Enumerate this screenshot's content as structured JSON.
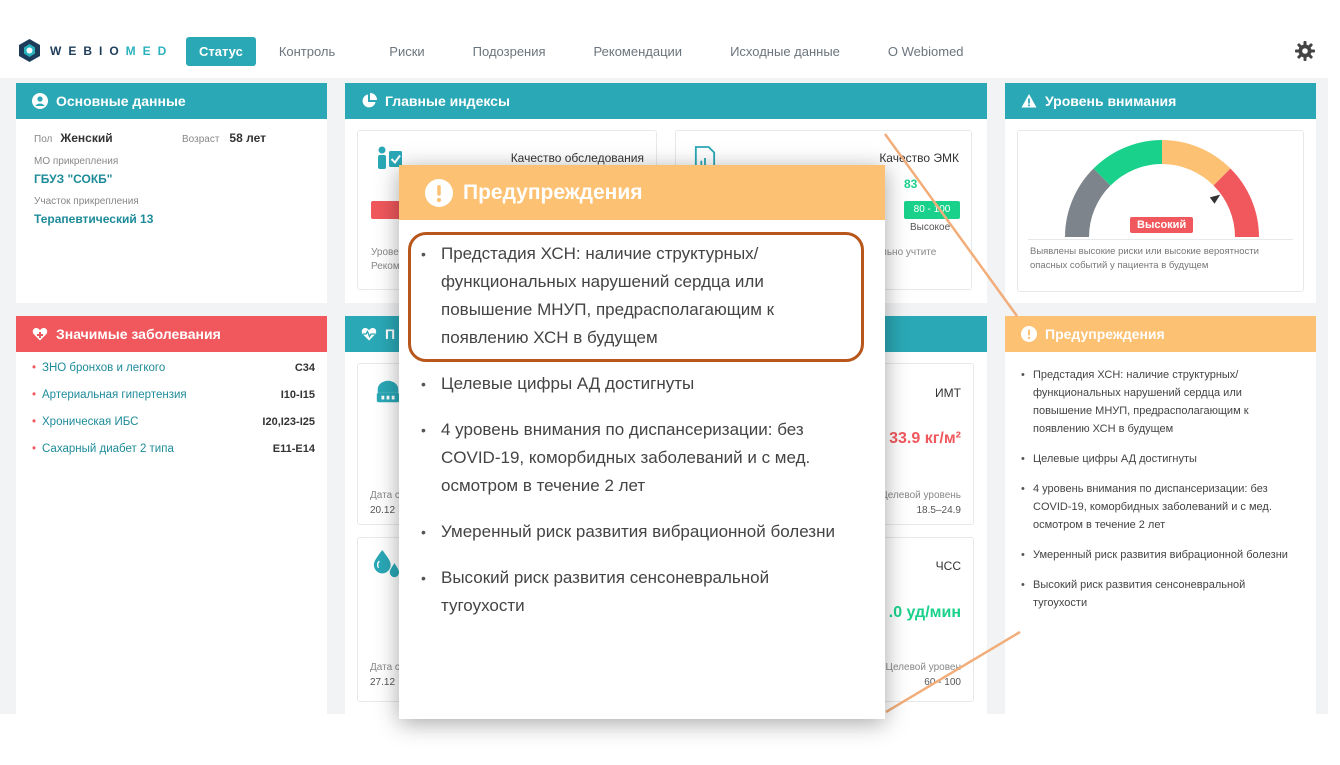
{
  "brand": {
    "name_part1": "WEBIO",
    "name_part2": "MED"
  },
  "nav": {
    "items": [
      {
        "label": "Статус",
        "active": true
      },
      {
        "label": "Контроль",
        "active": false
      },
      {
        "label": "Риски",
        "active": false
      },
      {
        "label": "Подозрения",
        "active": false
      },
      {
        "label": "Рекомендации",
        "active": false
      },
      {
        "label": "Исходные данные",
        "active": false
      },
      {
        "label": "О Webiomed",
        "active": false
      }
    ]
  },
  "basic": {
    "title": "Основные данные",
    "sex_label": "Пол",
    "sex_value": "Женский",
    "age_label": "Возраст",
    "age_value": "58 лет",
    "mo_label": "МО прикрепления",
    "mo_value": "ГБУЗ \"СОКБ\"",
    "district_label": "Участок прикрепления",
    "district_value": "Терапевтический 13"
  },
  "diseases": {
    "title": "Значимые заболевания",
    "items": [
      {
        "name": "ЗНО бронхов и легкого",
        "code": "C34"
      },
      {
        "name": "Артериальная гипертензия",
        "code": "I10-I15"
      },
      {
        "name": "Хроническая ИБС",
        "code": "I20,I23-I25"
      },
      {
        "name": "Сахарный диабет 2 типа",
        "code": "E11-E14"
      }
    ]
  },
  "indices": {
    "title": "Главные индексы",
    "card1_title": "Качество обследования",
    "card1_note": "Урове",
    "card1_note2": "Реком",
    "card2_title": "Качество ЭМК",
    "card2_value": "83",
    "card2_range": "80 - 100",
    "card2_level": "Высокое",
    "card2_note": "льно учтите"
  },
  "params": {
    "title_visible": "П",
    "imt_label": "ИМТ",
    "imt_value": "33.9 кг/м²",
    "imt_date_label": "Дата с",
    "imt_date": "20.12",
    "imt_target_label": "Целевой уровень",
    "imt_target": "18.5–24.9",
    "hr_label": "ЧСС",
    "hr_value": ".0 уд/мин",
    "hr_date_label": "Дата с",
    "hr_date": "27.12",
    "hr_target_label": "Целевой уровен",
    "hr_target": "60 - 100"
  },
  "attention": {
    "title": "Уровень внимания",
    "gauge_label": "Высокий",
    "gauge_level": 0.8,
    "description": "Выявлены высокие риски или высокие вероятности опасных событий у пациента в будущем"
  },
  "warnings": {
    "title": "Предупреждения",
    "items": [
      "Предстадия ХСН: наличие структурных/функциональных нарушений сердца или повышение МНУП, предрасполагающим к появлению ХСН в будущем",
      "Целевые цифры АД достигнуты",
      "4 уровень внимания по диспансеризации: без COVID-19, коморбидных заболеваний и с мед. осмотром в течение 2 лет",
      "Умеренный риск развития вибрационной болезни",
      "Высокий риск развития сенсоневральной тугоухости"
    ]
  },
  "modal": {
    "title": "Предупреждения",
    "items": [
      "Предстадия ХСН: наличие структурных/ функциональных нарушений сердца или повышение МНУП, предрасполагающим к появлению ХСН в будущем",
      "Целевые цифры АД достигнуты",
      "4 уровень внимания по диспансеризации: без COVID-19, коморбидных заболеваний и с мед. осмотром в течение 2 лет",
      "Умеренный риск развития вибрационной болезни",
      "Высокий риск развития сенсоневральной тугоухости"
    ]
  },
  "colors": {
    "teal": "#2aa8b6",
    "red": "#f0585d",
    "orange": "#fdc173",
    "green": "#19d18b",
    "gray": "#7d848b",
    "highlight": "#b8561c"
  }
}
